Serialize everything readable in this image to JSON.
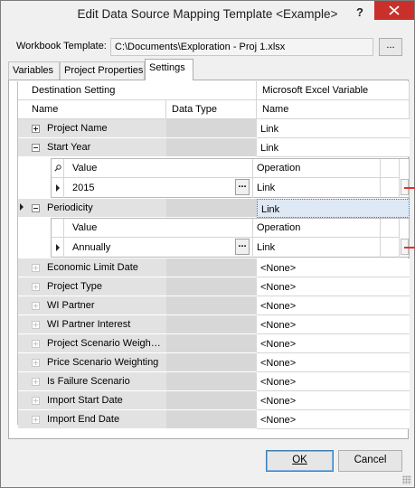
{
  "window": {
    "title": "Edit Data Source Mapping Template <Example>",
    "help_label": "?",
    "close_label": "close"
  },
  "workbook": {
    "label": "Workbook Template:",
    "value": "C:\\Documents\\Exploration - Proj 1.xlsx",
    "browse_label": "..."
  },
  "tabs": [
    "Variables",
    "Project Properties",
    "Settings"
  ],
  "active_tab": "Settings",
  "grid": {
    "group_headers": {
      "destination": "Destination Setting",
      "excel": "Microsoft Excel Variable"
    },
    "col_headers": {
      "name": "Name",
      "data_type": "Data Type",
      "variable": "Name"
    },
    "rows": [
      {
        "name": "Project Name",
        "variable": "Link"
      },
      {
        "name": "Start Year",
        "variable": "Link"
      },
      {
        "name": "Periodicity",
        "variable": "Link"
      },
      {
        "name": "Economic Limit Date",
        "variable": "<None>"
      },
      {
        "name": "Project Type",
        "variable": "<None>"
      },
      {
        "name": "WI Partner",
        "variable": "<None>"
      },
      {
        "name": "WI Partner Interest",
        "variable": "<None>"
      },
      {
        "name": "Project Scenario Weigh…",
        "variable": "<None>"
      },
      {
        "name": "Price Scenario Weighting",
        "variable": "<None>"
      },
      {
        "name": "Is Failure Scenario",
        "variable": "<None>"
      },
      {
        "name": "Import Start Date",
        "variable": "<None>"
      },
      {
        "name": "Import End Date",
        "variable": "<None>"
      }
    ],
    "subgrids": [
      {
        "parent": "Start Year",
        "headers": {
          "value": "Value",
          "operation": "Operation"
        },
        "value": "2015",
        "operation": "Link",
        "ellipsis": "..."
      },
      {
        "parent": "Periodicity",
        "headers": {
          "value": "Value",
          "operation": "Operation"
        },
        "value": "Annually",
        "operation": "Link",
        "ellipsis": "..."
      }
    ]
  },
  "buttons": {
    "ok": "OK",
    "cancel": "Cancel"
  },
  "colors": {
    "accent": "#3c7fb1",
    "close": "#c9302c",
    "delete": "#e03030",
    "selected_cell": "#dfe8f5"
  }
}
